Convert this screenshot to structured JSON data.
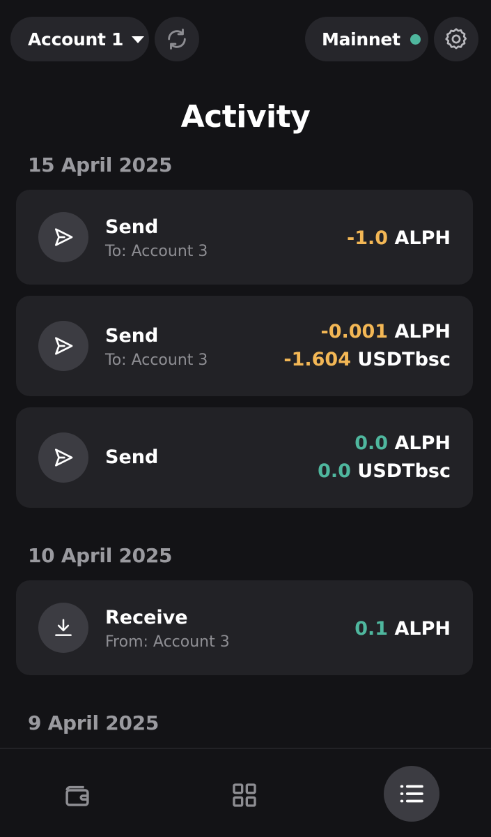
{
  "header": {
    "account_label": "Account 1",
    "network_label": "Mainnet",
    "network_status_color": "#4fb79e"
  },
  "page": {
    "title": "Activity"
  },
  "groups": [
    {
      "date": "15 April 2025",
      "items": [
        {
          "type": "Send",
          "subtitle": "To: Account 3",
          "icon": "send-icon",
          "amounts": [
            {
              "value": "-1.0",
              "symbol": "ALPH",
              "sign": "negative"
            }
          ]
        },
        {
          "type": "Send",
          "subtitle": "To: Account 3",
          "icon": "send-icon",
          "amounts": [
            {
              "value": "-0.001",
              "symbol": "ALPH",
              "sign": "negative"
            },
            {
              "value": "-1.604",
              "symbol": "USDTbsc",
              "sign": "negative"
            }
          ]
        },
        {
          "type": "Send",
          "subtitle": "",
          "icon": "send-icon",
          "amounts": [
            {
              "value": "0.0",
              "symbol": "ALPH",
              "sign": "positive"
            },
            {
              "value": "0.0",
              "symbol": "USDTbsc",
              "sign": "positive"
            }
          ]
        }
      ]
    },
    {
      "date": "10 April 2025",
      "items": [
        {
          "type": "Receive",
          "subtitle": "From: Account 3",
          "icon": "download-icon",
          "amounts": [
            {
              "value": "0.1",
              "symbol": "ALPH",
              "sign": "positive"
            }
          ]
        }
      ]
    },
    {
      "date": "9 April 2025",
      "items": []
    }
  ],
  "colors": {
    "negative": "#f3b755",
    "positive": "#4fb79e",
    "background": "#131316",
    "card": "#222226"
  },
  "bottom_nav": [
    {
      "icon": "wallet-icon",
      "active": false
    },
    {
      "icon": "apps-grid-icon",
      "active": false
    },
    {
      "icon": "activity-list-icon",
      "active": true
    }
  ]
}
